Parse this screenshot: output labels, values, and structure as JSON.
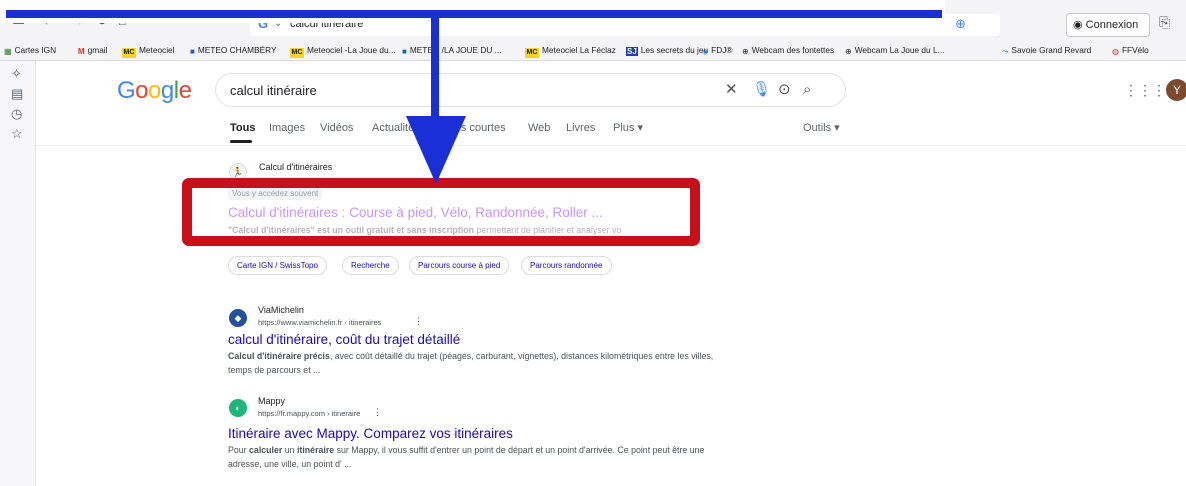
{
  "browser": {
    "url": "calcul itinéraire",
    "login_label": "Connexion"
  },
  "bookmarks": [
    {
      "label": "Cartes IGN",
      "icon": "map-icon"
    },
    {
      "label": "gmail",
      "icon": "gmail-icon"
    },
    {
      "label": "Meteociel",
      "icon": "mc-icon"
    },
    {
      "label": "METEO CHAMBÉRY",
      "icon": "weather-icon"
    },
    {
      "label": "Meteociel -La Joue du...",
      "icon": "mc-icon"
    },
    {
      "label": "METEO /LA JOUE DU ...",
      "icon": "weather-icon"
    },
    {
      "label": "Meteociel La Féclaz",
      "icon": "mc-icon"
    },
    {
      "label": "Les secrets du jeu",
      "icon": "sj-icon"
    },
    {
      "label": "FDJ®",
      "icon": "fdj-icon"
    },
    {
      "label": "Webcam des fontettes",
      "icon": "globe-icon"
    },
    {
      "label": "Webcam La Joue du L...",
      "icon": "globe-icon"
    },
    {
      "label": "Savoie Grand Revard",
      "icon": "savoie-icon"
    },
    {
      "label": "FFVélo",
      "icon": "ffvelo-icon"
    }
  ],
  "google": {
    "logo": "Google",
    "query": "calcul itinéraire",
    "tabs": [
      "Tous",
      "Images",
      "Vidéos",
      "Actualités",
      "Vidéos courtes",
      "Web",
      "Livres",
      "Plus ▾"
    ],
    "tools": "Outils ▾",
    "avatar_letter": "Y"
  },
  "results": [
    {
      "site": "Calcul d'itinéraires",
      "badge": "Vous y accédez souvent",
      "title": "Calcul d'itinéraires : Course à pied, Vélo, Randonnée, Roller ...",
      "snippet_bold": "\"Calcul d'itinéraires\" est un outil gratuit et sans inscription",
      "snippet_rest": " permettant de planifier et analyser vo",
      "chips": [
        "Carte IGN / SwissTopo",
        "Recherche",
        "Parcours course à pied",
        "Parcours randonnée"
      ]
    },
    {
      "site": "ViaMichelin",
      "cite": "https://www.viamichelin.fr › itineraires",
      "title": "calcul d'itinéraire, coût du trajet détaillé",
      "snippet_bold": "Calcul d'itinéraire précis",
      "snippet_rest": ", avec coût détaillé du trajet (péages, carburant, vignettes), distances kilométriques entre les villes, temps de parcours et ..."
    },
    {
      "site": "Mappy",
      "cite": "https://fr.mappy.com › itineraire",
      "title": "Itinéraire avec Mappy. Comparez vos itinéraires",
      "snippet_pre": "Pour ",
      "snippet_b1": "calculer",
      "snippet_mid": " un ",
      "snippet_b2": "itinéraire",
      "snippet_rest": " sur Mappy, il vous suffit d'entrer un point de départ et un point d'arrivée. Ce point peut être une adresse, une ville, un point d' ..."
    }
  ],
  "annotation": {
    "arrow_color": "#1a2fd6",
    "box_color": "#c8101a"
  }
}
